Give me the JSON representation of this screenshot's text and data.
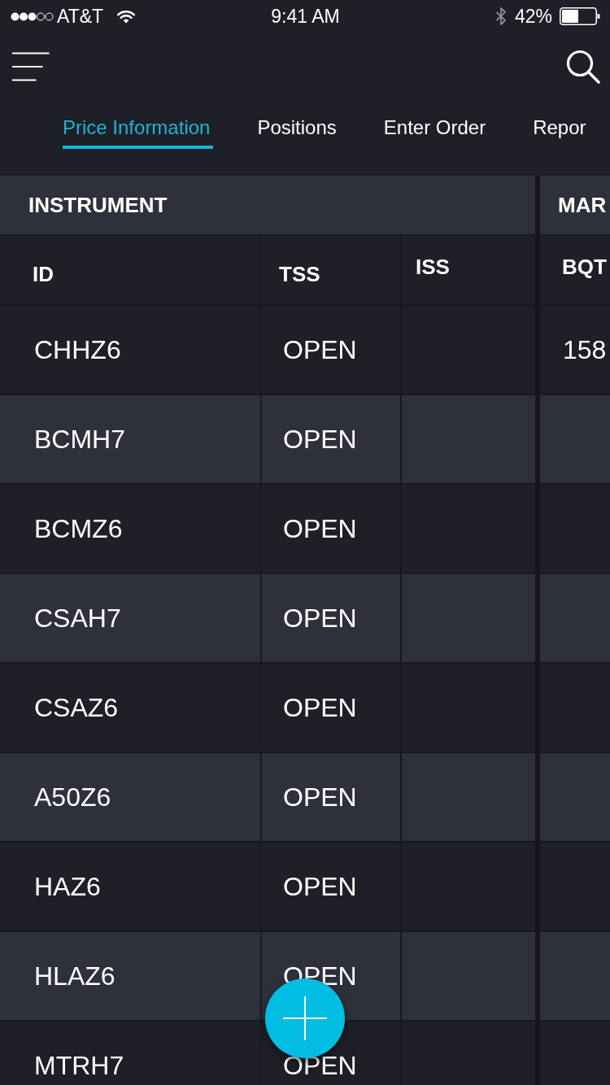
{
  "status_bar": {
    "carrier": "AT&T",
    "time": "9:41 AM",
    "battery": "42%"
  },
  "tabs": [
    {
      "label": "Price Information",
      "selected": true
    },
    {
      "label": "Positions",
      "selected": false
    },
    {
      "label": "Enter Order",
      "selected": false
    },
    {
      "label": "Repor",
      "selected": false
    }
  ],
  "table": {
    "column_groups": [
      "INSTRUMENT",
      "MAR"
    ],
    "columns": [
      "ID",
      "TSS",
      "ISS",
      "BQT"
    ],
    "rows": [
      {
        "id": "CHHZ6",
        "tss": "OPEN",
        "column_4": "158"
      },
      {
        "id": "BCMH7",
        "tss": "OPEN"
      },
      {
        "id": "BCMZ6",
        "tss": "OPEN"
      },
      {
        "id": "CSAH7",
        "tss": "OPEN"
      },
      {
        "id": "CSAZ6",
        "tss": "OPEN"
      },
      {
        "id": "A50Z6",
        "tss": "OPEN"
      },
      {
        "id": "HAZ6",
        "tss": "OPEN"
      },
      {
        "id": "HLAZ6",
        "tss": "OPEN"
      },
      {
        "id": "MTRH7",
        "tss": "OPEN"
      }
    ]
  }
}
